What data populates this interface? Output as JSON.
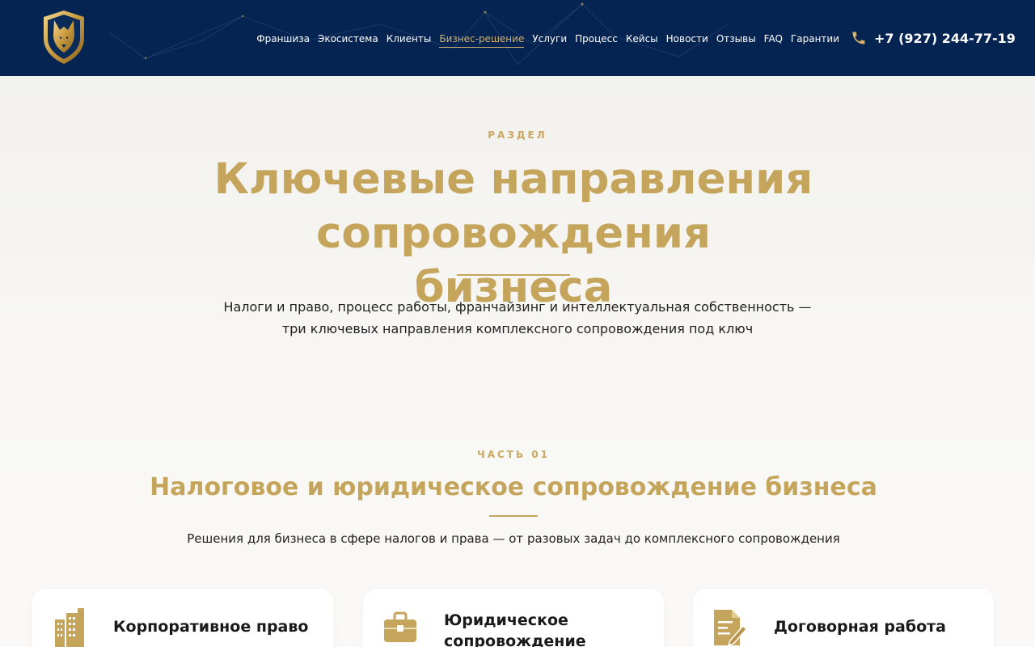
{
  "header": {
    "nav": [
      {
        "label": "Франшиза",
        "active": false
      },
      {
        "label": "Экосистема",
        "active": false
      },
      {
        "label": "Клиенты",
        "active": false
      },
      {
        "label": "Бизнес-решение",
        "active": true
      },
      {
        "label": "Услуги",
        "active": false
      },
      {
        "label": "Процесс",
        "active": false
      },
      {
        "label": "Кейсы",
        "active": false
      },
      {
        "label": "Новости",
        "active": false
      },
      {
        "label": "Отзывы",
        "active": false
      },
      {
        "label": "FAQ",
        "active": false
      },
      {
        "label": "Гарантии",
        "active": false
      }
    ],
    "phone": "+7 (927) 244-77-19",
    "phone_icon": "phone-icon",
    "logo_icon": "wolf-shield-logo"
  },
  "hero": {
    "eyebrow": "РАЗДЕЛ",
    "title_line1": "Ключевые направления сопровождения",
    "title_line2": "бизнеса",
    "subtitle_line1": "Налоги и право, процесс работы, франчайзинг и интеллектуальная собственность —",
    "subtitle_line2": "три ключевых направления комплексного сопровождения под ключ"
  },
  "section": {
    "eyebrow": "ЧАСТЬ 01",
    "title": "Налоговое и юридическое сопровождение бизнеса",
    "subtitle": "Решения для бизнеса в сфере налогов и права — от разовых задач до комплексного сопровождения"
  },
  "cards": [
    {
      "icon": "building-icon",
      "title_line1": "Корпоративное право",
      "title_line2": ""
    },
    {
      "icon": "briefcase-icon",
      "title_line1": "Юридическое",
      "title_line2": "сопровождение"
    },
    {
      "icon": "document-signature-icon",
      "title_line1": "Договорная работа",
      "title_line2": ""
    }
  ],
  "colors": {
    "header_bg": "#062452",
    "accent_gold": "#c5a55c",
    "page_bg": "#f4f3ef"
  }
}
